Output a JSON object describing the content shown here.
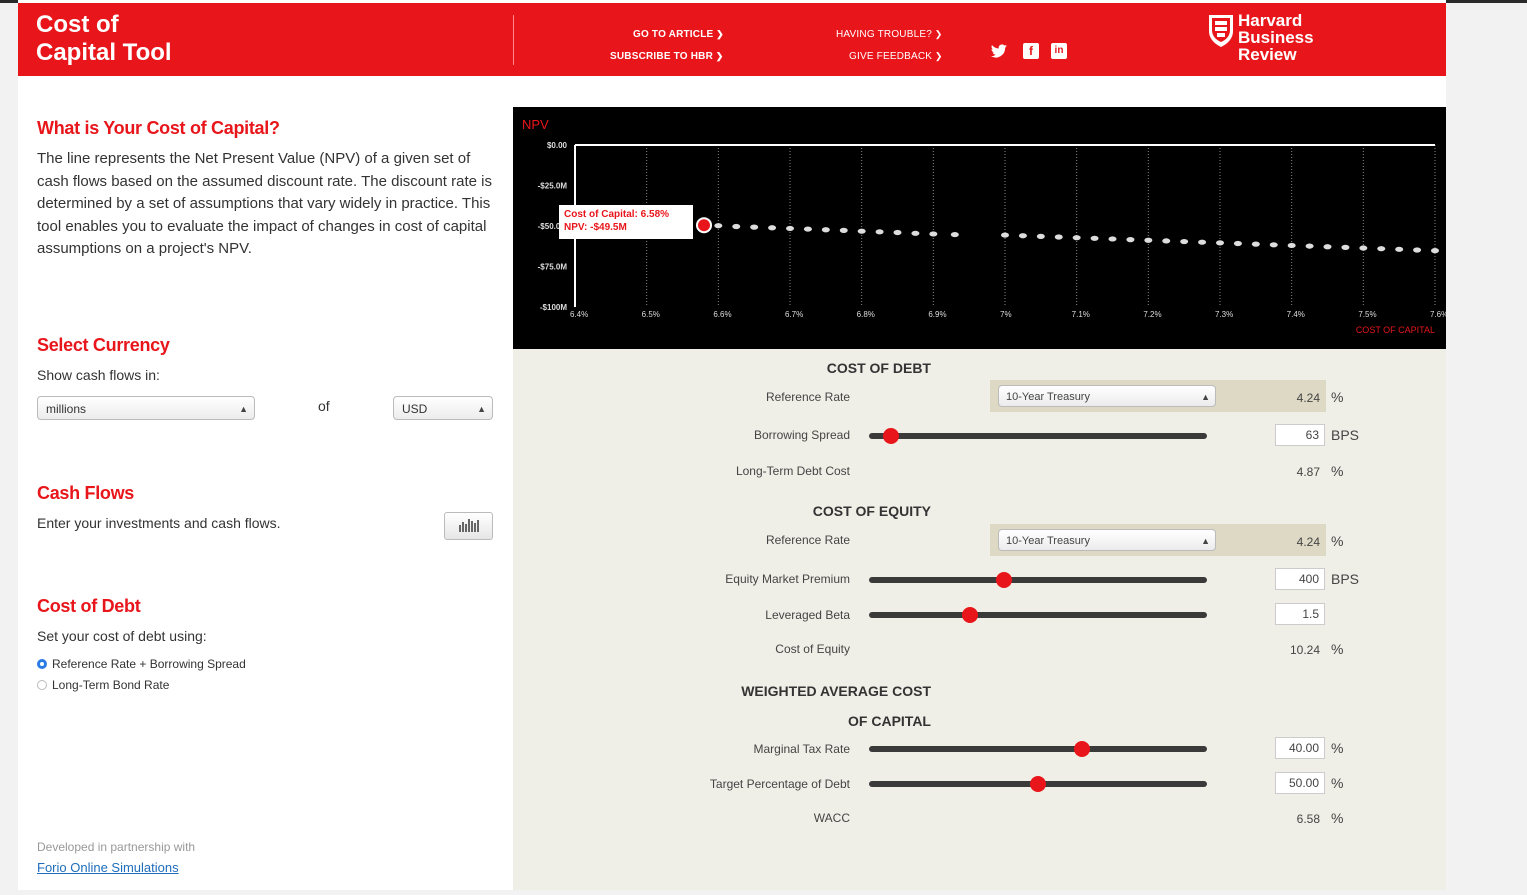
{
  "header": {
    "title_line1": "Cost of",
    "title_line2": "Capital Tool",
    "link_article": "GO TO ARTICLE",
    "link_subscribe": "SUBSCRIBE TO HBR",
    "link_trouble": "HAVING TROUBLE?",
    "link_feedback": "GIVE FEEDBACK",
    "social_icons": [
      "twitter-icon",
      "facebook-icon",
      "linkedin-icon"
    ],
    "logo": "Harvard Business Review"
  },
  "intro": {
    "heading": "What is Your Cost of Capital?",
    "text": "The line represents the Net Present Value (NPV) of a given set of cash flows based on the assumed discount rate. The discount rate is determined by a set of assumptions that vary widely in practice. This tool enables you to evaluate the impact of changes in cost of capital assumptions on a project's NPV."
  },
  "currency": {
    "heading": "Select Currency",
    "label": "Show cash flows in:",
    "unit_value": "millions",
    "of_label": "of",
    "currency_value": "USD"
  },
  "cashflows": {
    "heading": "Cash Flows",
    "label": "Enter your investments and cash flows.",
    "button_icon": "bar-chart-icon"
  },
  "costdebt_left": {
    "heading": "Cost of Debt",
    "label": "Set your cost of debt using:",
    "options": [
      "Reference Rate + Borrowing Spread",
      "Long-Term Bond Rate"
    ],
    "selected": "Reference Rate + Borrowing Spread"
  },
  "footer": {
    "note": "Developed in partnership with",
    "link": "Forio Online Simulations"
  },
  "chart_data": {
    "type": "scatter",
    "ylabel": "NPV",
    "xlabel": "COST OF CAPITAL",
    "x_ticks": [
      "6.4%",
      "6.5%",
      "6.6%",
      "6.7%",
      "6.8%",
      "6.9%",
      "7%",
      "7.1%",
      "7.2%",
      "7.3%",
      "7.4%",
      "7.5%",
      "7.6%"
    ],
    "y_ticks": [
      "$0.00",
      "-$25.0M",
      "-$50.0M",
      "-$75.0M",
      "-$100M"
    ],
    "xlim": [
      6.4,
      7.6
    ],
    "ylim": [
      -100,
      0
    ],
    "series": [
      {
        "values": [
          [
            6.58,
            -49.5
          ],
          [
            6.6,
            -49.8
          ],
          [
            6.625,
            -50.3
          ],
          [
            6.65,
            -50.7
          ],
          [
            6.675,
            -51.1
          ],
          [
            6.7,
            -51.5
          ],
          [
            6.725,
            -51.9
          ],
          [
            6.75,
            -52.3
          ],
          [
            6.775,
            -52.7
          ],
          [
            6.8,
            -53.2
          ],
          [
            6.825,
            -53.6
          ],
          [
            6.85,
            -54.0
          ],
          [
            6.875,
            -54.5
          ],
          [
            6.9,
            -54.9
          ],
          [
            6.93,
            -55.3
          ],
          [
            7.0,
            -55.6
          ],
          [
            7.025,
            -56.0
          ],
          [
            7.05,
            -56.4
          ],
          [
            7.075,
            -56.8
          ],
          [
            7.1,
            -57.2
          ],
          [
            7.125,
            -57.6
          ],
          [
            7.15,
            -58.0
          ],
          [
            7.175,
            -58.4
          ],
          [
            7.2,
            -58.8
          ],
          [
            7.225,
            -59.2
          ],
          [
            7.25,
            -59.6
          ],
          [
            7.275,
            -60.0
          ],
          [
            7.3,
            -60.4
          ],
          [
            7.325,
            -60.8
          ],
          [
            7.35,
            -61.2
          ],
          [
            7.375,
            -61.6
          ],
          [
            7.4,
            -62.0
          ],
          [
            7.425,
            -62.4
          ],
          [
            7.45,
            -62.8
          ],
          [
            7.475,
            -63.2
          ],
          [
            7.5,
            -63.6
          ],
          [
            7.525,
            -64.0
          ],
          [
            7.55,
            -64.4
          ],
          [
            7.575,
            -64.8
          ],
          [
            7.6,
            -65.2
          ]
        ]
      }
    ],
    "highlight": {
      "x": 6.58,
      "y": -49.5,
      "label1": "Cost of Capital:",
      "value1": "6.58%",
      "label2": "NPV:",
      "value2": "-$49.5M"
    },
    "grid": true
  },
  "panel": {
    "cost_of_debt": "COST OF DEBT",
    "debt_ref_label": "Reference Rate",
    "debt_ref_select": "10-Year Treasury",
    "debt_ref_value": "4.24",
    "spread_label": "Borrowing Spread",
    "spread_value": "63",
    "spread_level": 0.065,
    "ltdebt_label": "Long-Term Debt Cost",
    "ltdebt_value": "4.87",
    "cost_of_equity": "COST OF EQUITY",
    "eq_ref_label": "Reference Rate",
    "eq_ref_select": "10-Year Treasury",
    "eq_ref_value": "4.24",
    "emp_label": "Equity Market Premium",
    "emp_value": "400",
    "emp_level": 0.4,
    "beta_label": "Leveraged Beta",
    "beta_value": "1.5",
    "beta_level": 0.3,
    "coe_label": "Cost of Equity",
    "coe_value": "10.24",
    "wacc_title1": "WEIGHTED AVERAGE COST",
    "wacc_title2": "OF CAPITAL",
    "tax_label": "Marginal Tax Rate",
    "tax_value": "40.00",
    "tax_level": 0.63,
    "debtpct_label": "Target Percentage of Debt",
    "debtpct_value": "50.00",
    "debtpct_level": 0.5,
    "wacc_label": "WACC",
    "wacc_value": "6.58",
    "unit_pct": "%",
    "unit_bps": "BPS"
  },
  "colors": {
    "accent": "#e8161b",
    "chart_bg": "#000000",
    "panel_bg": "#f0efe7"
  }
}
